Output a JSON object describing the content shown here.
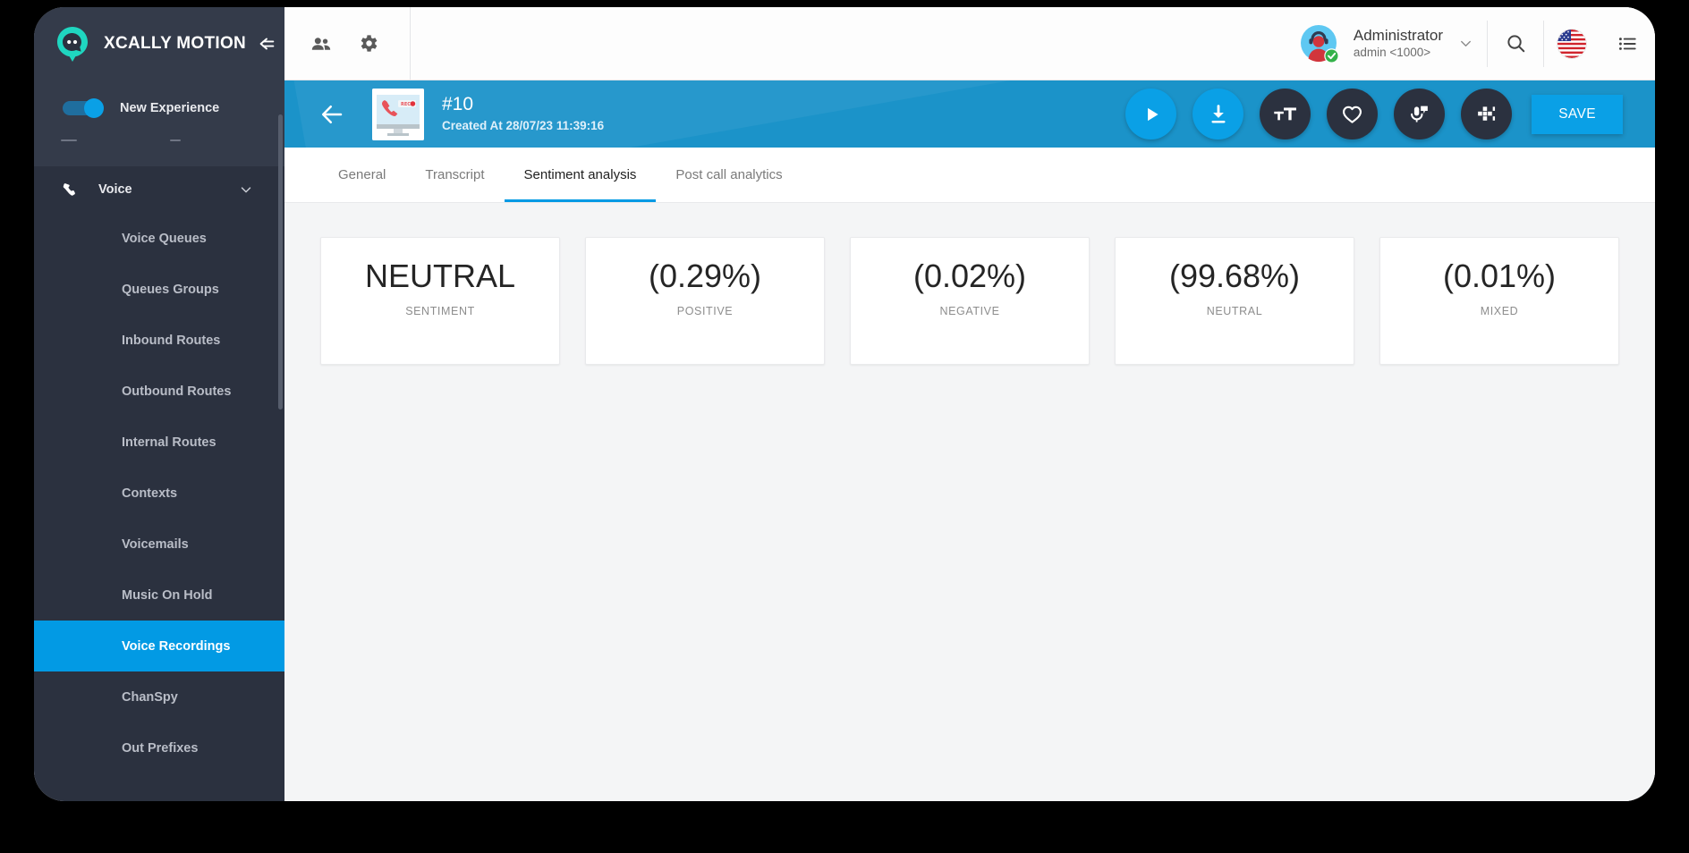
{
  "sidebar": {
    "brand": {
      "title": "XCALLY MOTION",
      "collapse_icon": "collapse-left-icon",
      "logo_icon": "xcally-chat-logo-icon"
    },
    "new_experience": {
      "label": "New Experience",
      "enabled": true
    },
    "group": {
      "label": "Voice",
      "icon": "phone-icon",
      "chevron": "chevron-down-icon"
    },
    "items": [
      {
        "label": "Voice Queues",
        "active": false
      },
      {
        "label": "Queues Groups",
        "active": false
      },
      {
        "label": "Inbound Routes",
        "active": false
      },
      {
        "label": "Outbound Routes",
        "active": false
      },
      {
        "label": "Internal Routes",
        "active": false
      },
      {
        "label": "Contexts",
        "active": false
      },
      {
        "label": "Voicemails",
        "active": false
      },
      {
        "label": "Music On Hold",
        "active": false
      },
      {
        "label": "Voice Recordings",
        "active": true
      },
      {
        "label": "ChanSpy",
        "active": false
      },
      {
        "label": "Out Prefixes",
        "active": false
      }
    ]
  },
  "topbar": {
    "icons": [
      {
        "name": "users-icon"
      },
      {
        "name": "gear-icon"
      }
    ],
    "user": {
      "name": "Administrator",
      "login": "admin <1000>",
      "caret": "chevron-down-icon",
      "status": "online"
    },
    "search_icon": "search-icon",
    "language_flag": "us-flag-icon",
    "list_icon": "list-icon"
  },
  "record_header": {
    "back_icon": "back-arrow-icon",
    "thumbnail_icon": "call-recording-thumbnail-icon",
    "title": "#10",
    "created_at": "Created At 28/07/23 11:39:16",
    "actions": [
      {
        "name": "play-button",
        "icon": "play-icon",
        "style": "blue"
      },
      {
        "name": "download-button",
        "icon": "download-icon",
        "style": "blue"
      },
      {
        "name": "transcript-text-button",
        "icon": "text-size-icon",
        "style": "dark"
      },
      {
        "name": "favorite-button",
        "icon": "heart-icon",
        "style": "dark"
      },
      {
        "name": "sentiment-button",
        "icon": "microphone-comment-icon",
        "style": "dark"
      },
      {
        "name": "analytics-button",
        "icon": "blocks-icon",
        "style": "dark"
      }
    ],
    "save_label": "SAVE"
  },
  "tabs": [
    {
      "label": "General",
      "active": false
    },
    {
      "label": "Transcript",
      "active": false
    },
    {
      "label": "Sentiment analysis",
      "active": true
    },
    {
      "label": "Post call analytics",
      "active": false
    }
  ],
  "sentiment_cards": [
    {
      "value": "NEUTRAL",
      "label": "SENTIMENT"
    },
    {
      "value": "(0.29%)",
      "label": "POSITIVE"
    },
    {
      "value": "(0.02%)",
      "label": "NEGATIVE"
    },
    {
      "value": "(99.68%)",
      "label": "NEUTRAL"
    },
    {
      "value": "(0.01%)",
      "label": "MIXED"
    }
  ],
  "colors": {
    "accent": "#029ae4",
    "accent_light": "#0aa0e6",
    "header_blue": "#1b93c9",
    "sidebar_bg": "#2b313f",
    "sidebar_header_bg": "#343b4a",
    "logo_teal": "#1fd6c0",
    "content_bg": "#f4f5f6"
  }
}
